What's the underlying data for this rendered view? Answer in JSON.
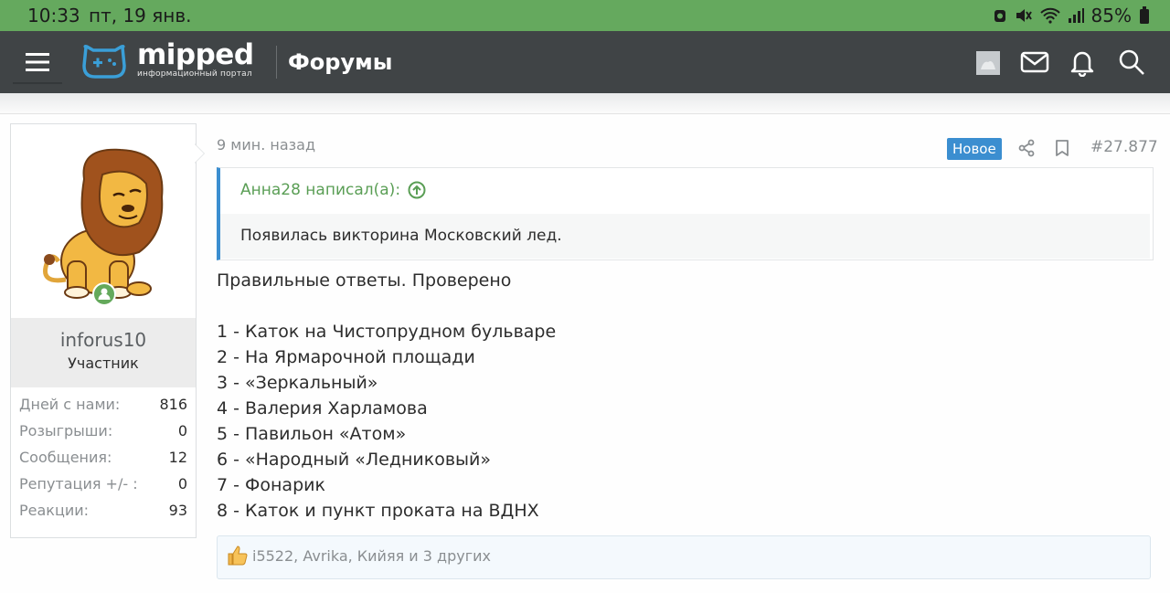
{
  "status_bar": {
    "time": "10:33",
    "date": "пт, 19 янв.",
    "battery": "85%",
    "icons": [
      "alarm-icon",
      "mute-icon",
      "wifi-icon",
      "signal-icon",
      "battery-icon"
    ]
  },
  "header": {
    "logo_text": "mipped",
    "logo_subtitle": "информационный портал",
    "section_title": "Форумы",
    "icons": [
      "menu-icon",
      "user-avatar",
      "mail-icon",
      "bell-icon",
      "search-icon"
    ]
  },
  "post": {
    "time": "9 мин. назад",
    "badge": "Новое",
    "number": "#27.877",
    "quote": {
      "author_line": "Анна28 написал(а):",
      "text": "Появилась викторина Московский лед."
    },
    "intro": "Правильные ответы. Проверено",
    "answers": [
      "1 - Каток на Чистопрудном бульваре",
      "2 - На Ярмарочной площади",
      "3 - «Зеркальный»",
      "4 - Валерия Харламова",
      "5 - Павильон «Атом»",
      "6 - «Народный «Ледниковый»",
      "7 - Фонарик",
      "8 - Каток и пункт проката на ВДНХ"
    ],
    "reactions_text": "i5522, Avrika, Кийяя и 3 других"
  },
  "user": {
    "name": "inforus10",
    "role": "Участник",
    "stats": [
      {
        "label": "Дней с нами:",
        "value": "816"
      },
      {
        "label": "Розыгрыши:",
        "value": "0"
      },
      {
        "label": "Сообщения:",
        "value": "12"
      },
      {
        "label": "Репутация +/- :",
        "value": "0"
      },
      {
        "label": "Реакции:",
        "value": "93"
      }
    ]
  },
  "colors": {
    "status_bar": "#65a95e",
    "navbar": "#404446",
    "accent_blue": "#3b8ed0",
    "quote_green": "#5a9e55",
    "online_green": "#64a95b"
  }
}
